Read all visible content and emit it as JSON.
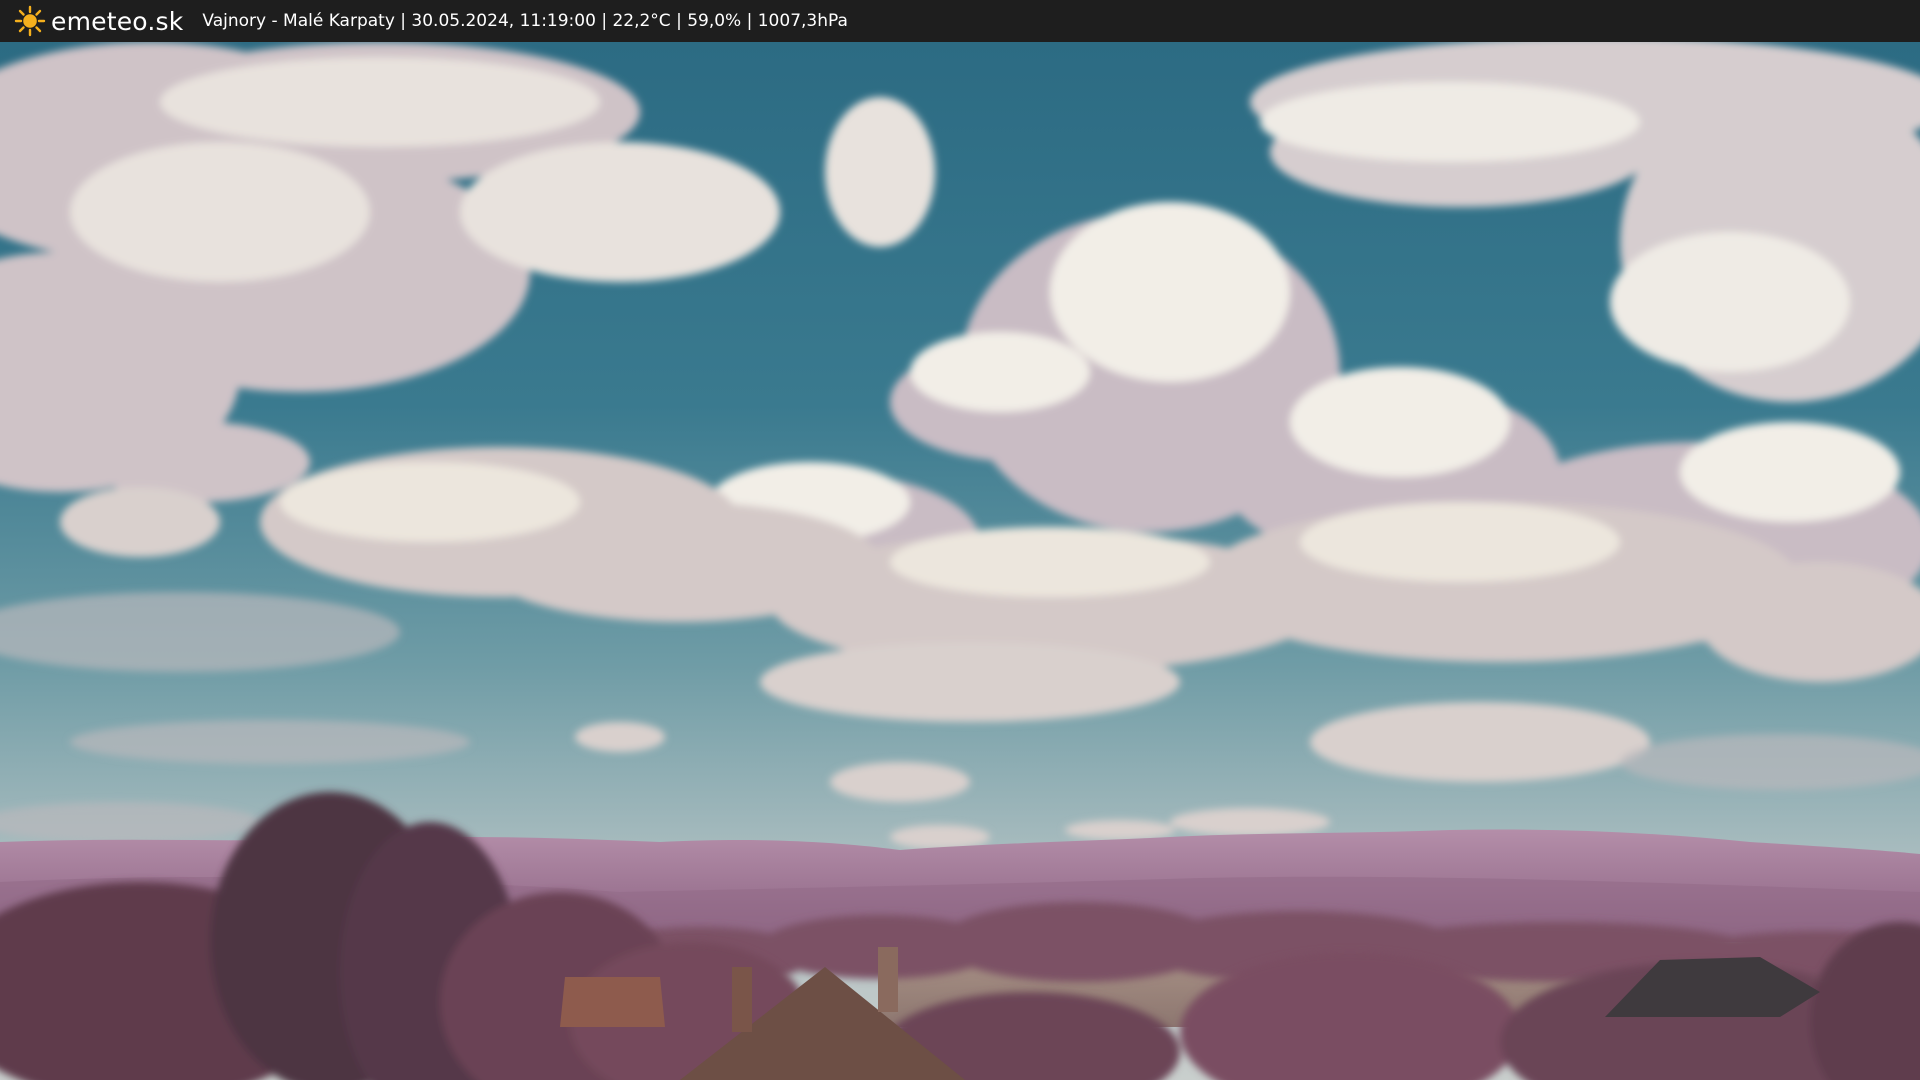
{
  "header": {
    "brand": "emeteo.sk",
    "location": "Vajnory - Malé Karpaty",
    "datetime": "30.05.2024, 11:19:00",
    "temperature": "22,2°C",
    "humidity": "59,0%",
    "pressure": "1007,3hPa",
    "info_line": "Vajnory - Malé Karpaty | 30.05.2024, 11:19:00 | 22,2°C | 59,0% | 1007,3hPa",
    "logo_icon": "sun-icon"
  },
  "colors": {
    "bar_background": "#1e1e1e",
    "sun": "#f5b01d",
    "sky_top": "#2f6f86",
    "sky_horizon": "#b9c7c8",
    "mountains": "#9d7391",
    "foliage": "#6e4656"
  }
}
